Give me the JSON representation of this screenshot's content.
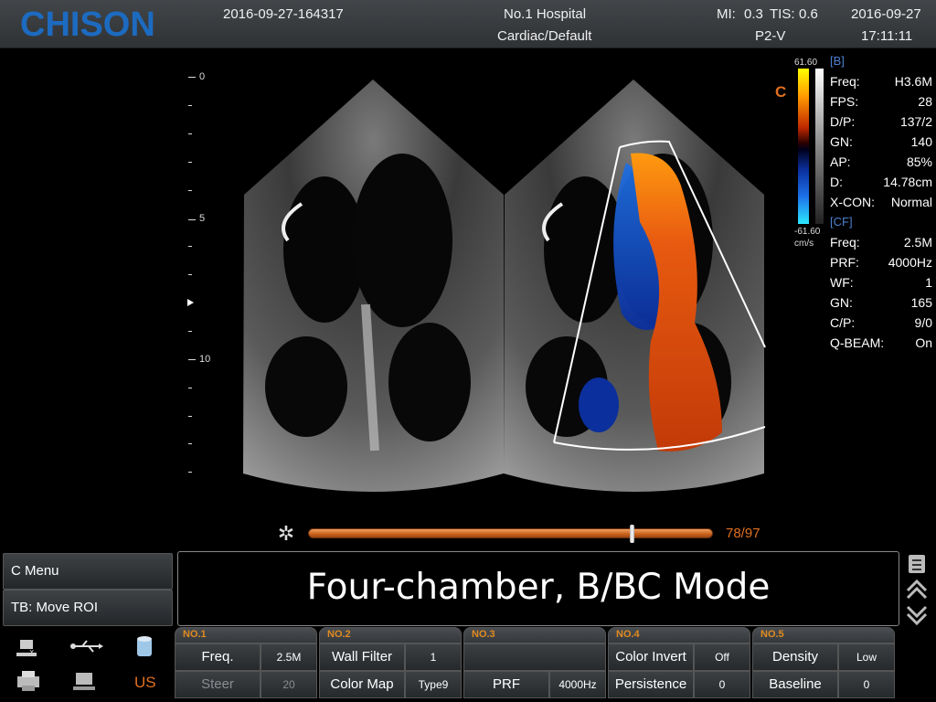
{
  "header": {
    "logo": "CHISON",
    "study_id": "2016-09-27-164317",
    "hospital": "No.1 Hospital",
    "preset": "Cardiac/Default",
    "mi_label": "MI:",
    "mi_value": "0.3",
    "tis_label": "TIS:",
    "tis_value": "0.6",
    "probe": "P2-V",
    "date": "2016-09-27",
    "time": "17:11:11"
  },
  "depth_scale": {
    "labels": [
      "0",
      "5",
      "10"
    ]
  },
  "color_bar": {
    "max": "61.60",
    "min": "-61.60",
    "unit": "cm/s"
  },
  "mode_indicator": "C",
  "params": {
    "b_section": "[B]",
    "b": [
      {
        "k": "Freq:",
        "v": "H3.6M"
      },
      {
        "k": "FPS:",
        "v": "28"
      },
      {
        "k": "D/P:",
        "v": "137/2"
      },
      {
        "k": "GN:",
        "v": "140"
      },
      {
        "k": "AP:",
        "v": "85%"
      },
      {
        "k": "D:",
        "v": "14.78cm"
      },
      {
        "k": "X-CON:",
        "v": "Normal"
      }
    ],
    "cf_section": "[CF]",
    "cf": [
      {
        "k": "Freq:",
        "v": "2.5M"
      },
      {
        "k": "PRF:",
        "v": "4000Hz"
      },
      {
        "k": "WF:",
        "v": "1"
      },
      {
        "k": "GN:",
        "v": "165"
      },
      {
        "k": "C/P:",
        "v": "9/0"
      },
      {
        "k": "Q-BEAM:",
        "v": "On"
      }
    ]
  },
  "cine": {
    "counter": "78/97",
    "current_frame": 78,
    "total_frames": 97
  },
  "menu": {
    "c_menu": "C Menu",
    "tb_move_roi": "TB: Move ROI"
  },
  "message": "Four-chamber, B/BC Mode",
  "status": {
    "us_label": "US"
  },
  "groups": [
    {
      "title": "NO.1",
      "r1": {
        "label": "Freq.",
        "value": "2.5M"
      },
      "r2": {
        "label": "Steer",
        "value": "20"
      }
    },
    {
      "title": "NO.2",
      "r1": {
        "label": "Wall Filter",
        "value": "1"
      },
      "r2": {
        "label": "Color Map",
        "value": "Type9"
      }
    },
    {
      "title": "NO.3",
      "r1": {
        "label": "",
        "value": ""
      },
      "r2": {
        "label": "PRF",
        "value": "4000Hz"
      }
    },
    {
      "title": "NO.4",
      "r1": {
        "label": "Color Invert",
        "value": "Off"
      },
      "r2": {
        "label": "Persistence",
        "value": "0"
      }
    },
    {
      "title": "NO.5",
      "r1": {
        "label": "Density",
        "value": "Low"
      },
      "r2": {
        "label": "Baseline",
        "value": "0"
      }
    }
  ]
}
